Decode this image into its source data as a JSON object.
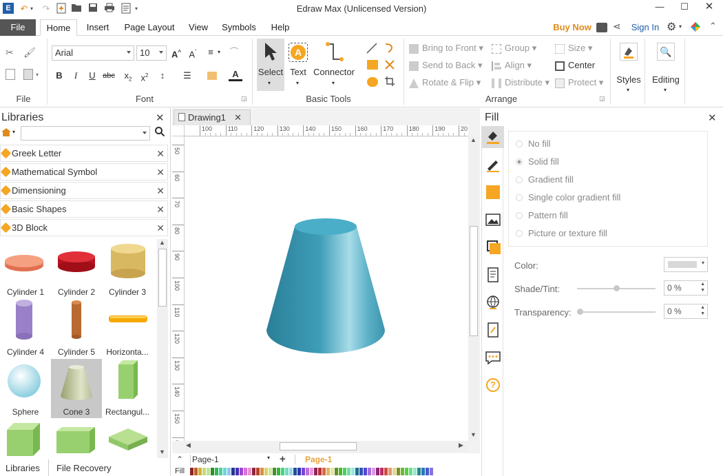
{
  "window": {
    "title": "Edraw Max (Unlicensed Version)"
  },
  "tabs": [
    "File",
    "Home",
    "Insert",
    "Page Layout",
    "View",
    "Symbols",
    "Help"
  ],
  "account": {
    "buy_now": "Buy Now",
    "sign_in": "Sign In"
  },
  "ribbon": {
    "file_group": "File",
    "font_group": "Font",
    "font_name": "Arial",
    "font_size": "10",
    "basic_tools_group": "Basic Tools",
    "select": "Select",
    "text": "Text",
    "connector": "Connector",
    "arrange_group": "Arrange",
    "bring_to_front": "Bring to Front",
    "send_to_back": "Send to Back",
    "rotate_flip": "Rotate & Flip",
    "group": "Group",
    "align": "Align",
    "distribute": "Distribute",
    "size": "Size",
    "center": "Center",
    "protect": "Protect",
    "styles": "Styles",
    "editing": "Editing"
  },
  "libraries": {
    "title": "Libraries",
    "categories": [
      "Greek Letter",
      "Mathematical Symbol",
      "Dimensioning",
      "Basic Shapes",
      "3D Block"
    ],
    "shapes": [
      "Cylinder 1",
      "Cylinder 2",
      "Cylinder 3",
      "Cylinder 4",
      "Cylinder 5",
      "Horizonta...",
      "Sphere",
      "Cone 3",
      "Rectangul..."
    ],
    "bottom_tabs": [
      "Libraries",
      "File Recovery"
    ]
  },
  "document": {
    "tab": "Drawing1",
    "h_ticks": [
      "100",
      "110",
      "120",
      "130",
      "140",
      "150",
      "160",
      "170",
      "180",
      "190",
      "20"
    ],
    "v_ticks": [
      "50",
      "60",
      "70",
      "80",
      "90",
      "100",
      "110",
      "120",
      "130",
      "140",
      "150",
      "60"
    ],
    "page_selector": "Page-1",
    "active_page": "Page-1",
    "fill_label": "Fill"
  },
  "fill_panel": {
    "title": "Fill",
    "options": [
      "No fill",
      "Solid fill",
      "Gradient fill",
      "Single color gradient fill",
      "Pattern fill",
      "Picture or texture fill"
    ],
    "selected": "Solid fill",
    "color_label": "Color:",
    "shade_label": "Shade/Tint:",
    "shade_value": "0 %",
    "transparency_label": "Transparency:",
    "transparency_value": "0 %"
  },
  "colors": {
    "accent": "#e8a33c",
    "cone": "#3a9ab4",
    "file_tab": "#555555"
  }
}
